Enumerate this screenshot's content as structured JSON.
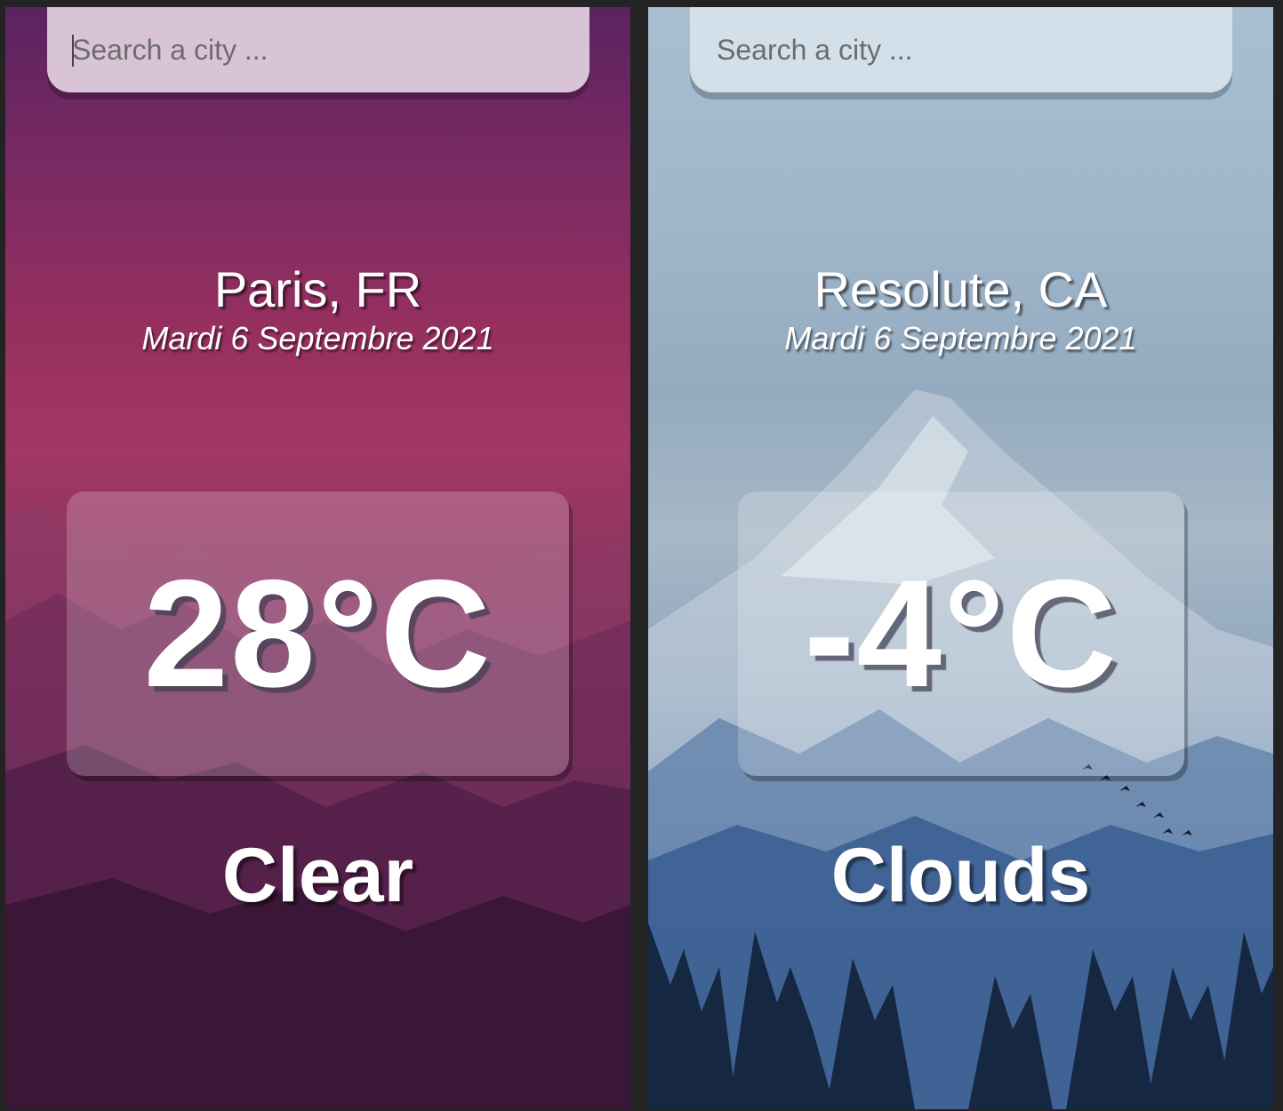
{
  "panels": [
    {
      "search": {
        "placeholder": "Search a city ...",
        "value": ""
      },
      "location": "Paris, FR",
      "date": "Mardi 6 Septembre 2021",
      "temperature": "28°C",
      "condition": "Clear",
      "theme": {
        "top": "#5a2360",
        "mid": "#a33763",
        "bottom": "#2a112c"
      }
    },
    {
      "search": {
        "placeholder": "Search a city ...",
        "value": ""
      },
      "location": "Resolute, CA",
      "date": "Mardi 6 Septembre 2021",
      "temperature": "-4°C",
      "condition": "Clouds",
      "theme": {
        "top": "#a8bfd2",
        "mid": "#5e7fa6",
        "bottom": "#1b2f55"
      }
    }
  ]
}
